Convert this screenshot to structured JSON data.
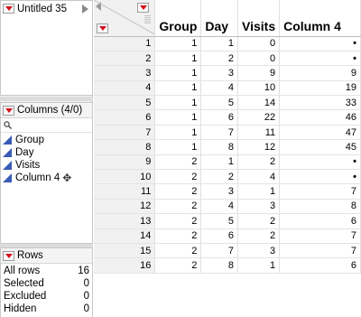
{
  "table_panel": {
    "title": "Untitled 35"
  },
  "columns_panel": {
    "title": "Columns (4/0)",
    "items": [
      {
        "label": "Group"
      },
      {
        "label": "Day"
      },
      {
        "label": "Visits"
      },
      {
        "label": "Column 4"
      }
    ]
  },
  "rows_panel": {
    "title": "Rows",
    "stats": [
      {
        "label": "All rows",
        "value": "16"
      },
      {
        "label": "Selected",
        "value": "0"
      },
      {
        "label": "Excluded",
        "value": "0"
      },
      {
        "label": "Hidden",
        "value": "0"
      }
    ]
  },
  "grid": {
    "headers": [
      "Group",
      "Day",
      "Visits",
      "Column 4"
    ],
    "rows": [
      {
        "n": "1",
        "cells": [
          "1",
          "1",
          "0",
          "•"
        ]
      },
      {
        "n": "2",
        "cells": [
          "1",
          "2",
          "0",
          "•"
        ]
      },
      {
        "n": "3",
        "cells": [
          "1",
          "3",
          "9",
          "9"
        ]
      },
      {
        "n": "4",
        "cells": [
          "1",
          "4",
          "10",
          "19"
        ]
      },
      {
        "n": "5",
        "cells": [
          "1",
          "5",
          "14",
          "33"
        ]
      },
      {
        "n": "6",
        "cells": [
          "1",
          "6",
          "22",
          "46"
        ]
      },
      {
        "n": "7",
        "cells": [
          "1",
          "7",
          "11",
          "47"
        ]
      },
      {
        "n": "8",
        "cells": [
          "1",
          "8",
          "12",
          "45"
        ]
      },
      {
        "n": "9",
        "cells": [
          "2",
          "1",
          "2",
          "•"
        ]
      },
      {
        "n": "10",
        "cells": [
          "2",
          "2",
          "4",
          "•"
        ]
      },
      {
        "n": "11",
        "cells": [
          "2",
          "3",
          "1",
          "7"
        ]
      },
      {
        "n": "12",
        "cells": [
          "2",
          "4",
          "3",
          "8"
        ]
      },
      {
        "n": "13",
        "cells": [
          "2",
          "5",
          "2",
          "6"
        ]
      },
      {
        "n": "14",
        "cells": [
          "2",
          "6",
          "2",
          "7"
        ]
      },
      {
        "n": "15",
        "cells": [
          "2",
          "7",
          "3",
          "7"
        ]
      },
      {
        "n": "16",
        "cells": [
          "2",
          "8",
          "1",
          "6"
        ]
      }
    ]
  },
  "colors": {
    "menu_triangle": "#d3121b",
    "column_icon": "#3a5cb8",
    "row_header_bg": "#f1f1f1"
  }
}
